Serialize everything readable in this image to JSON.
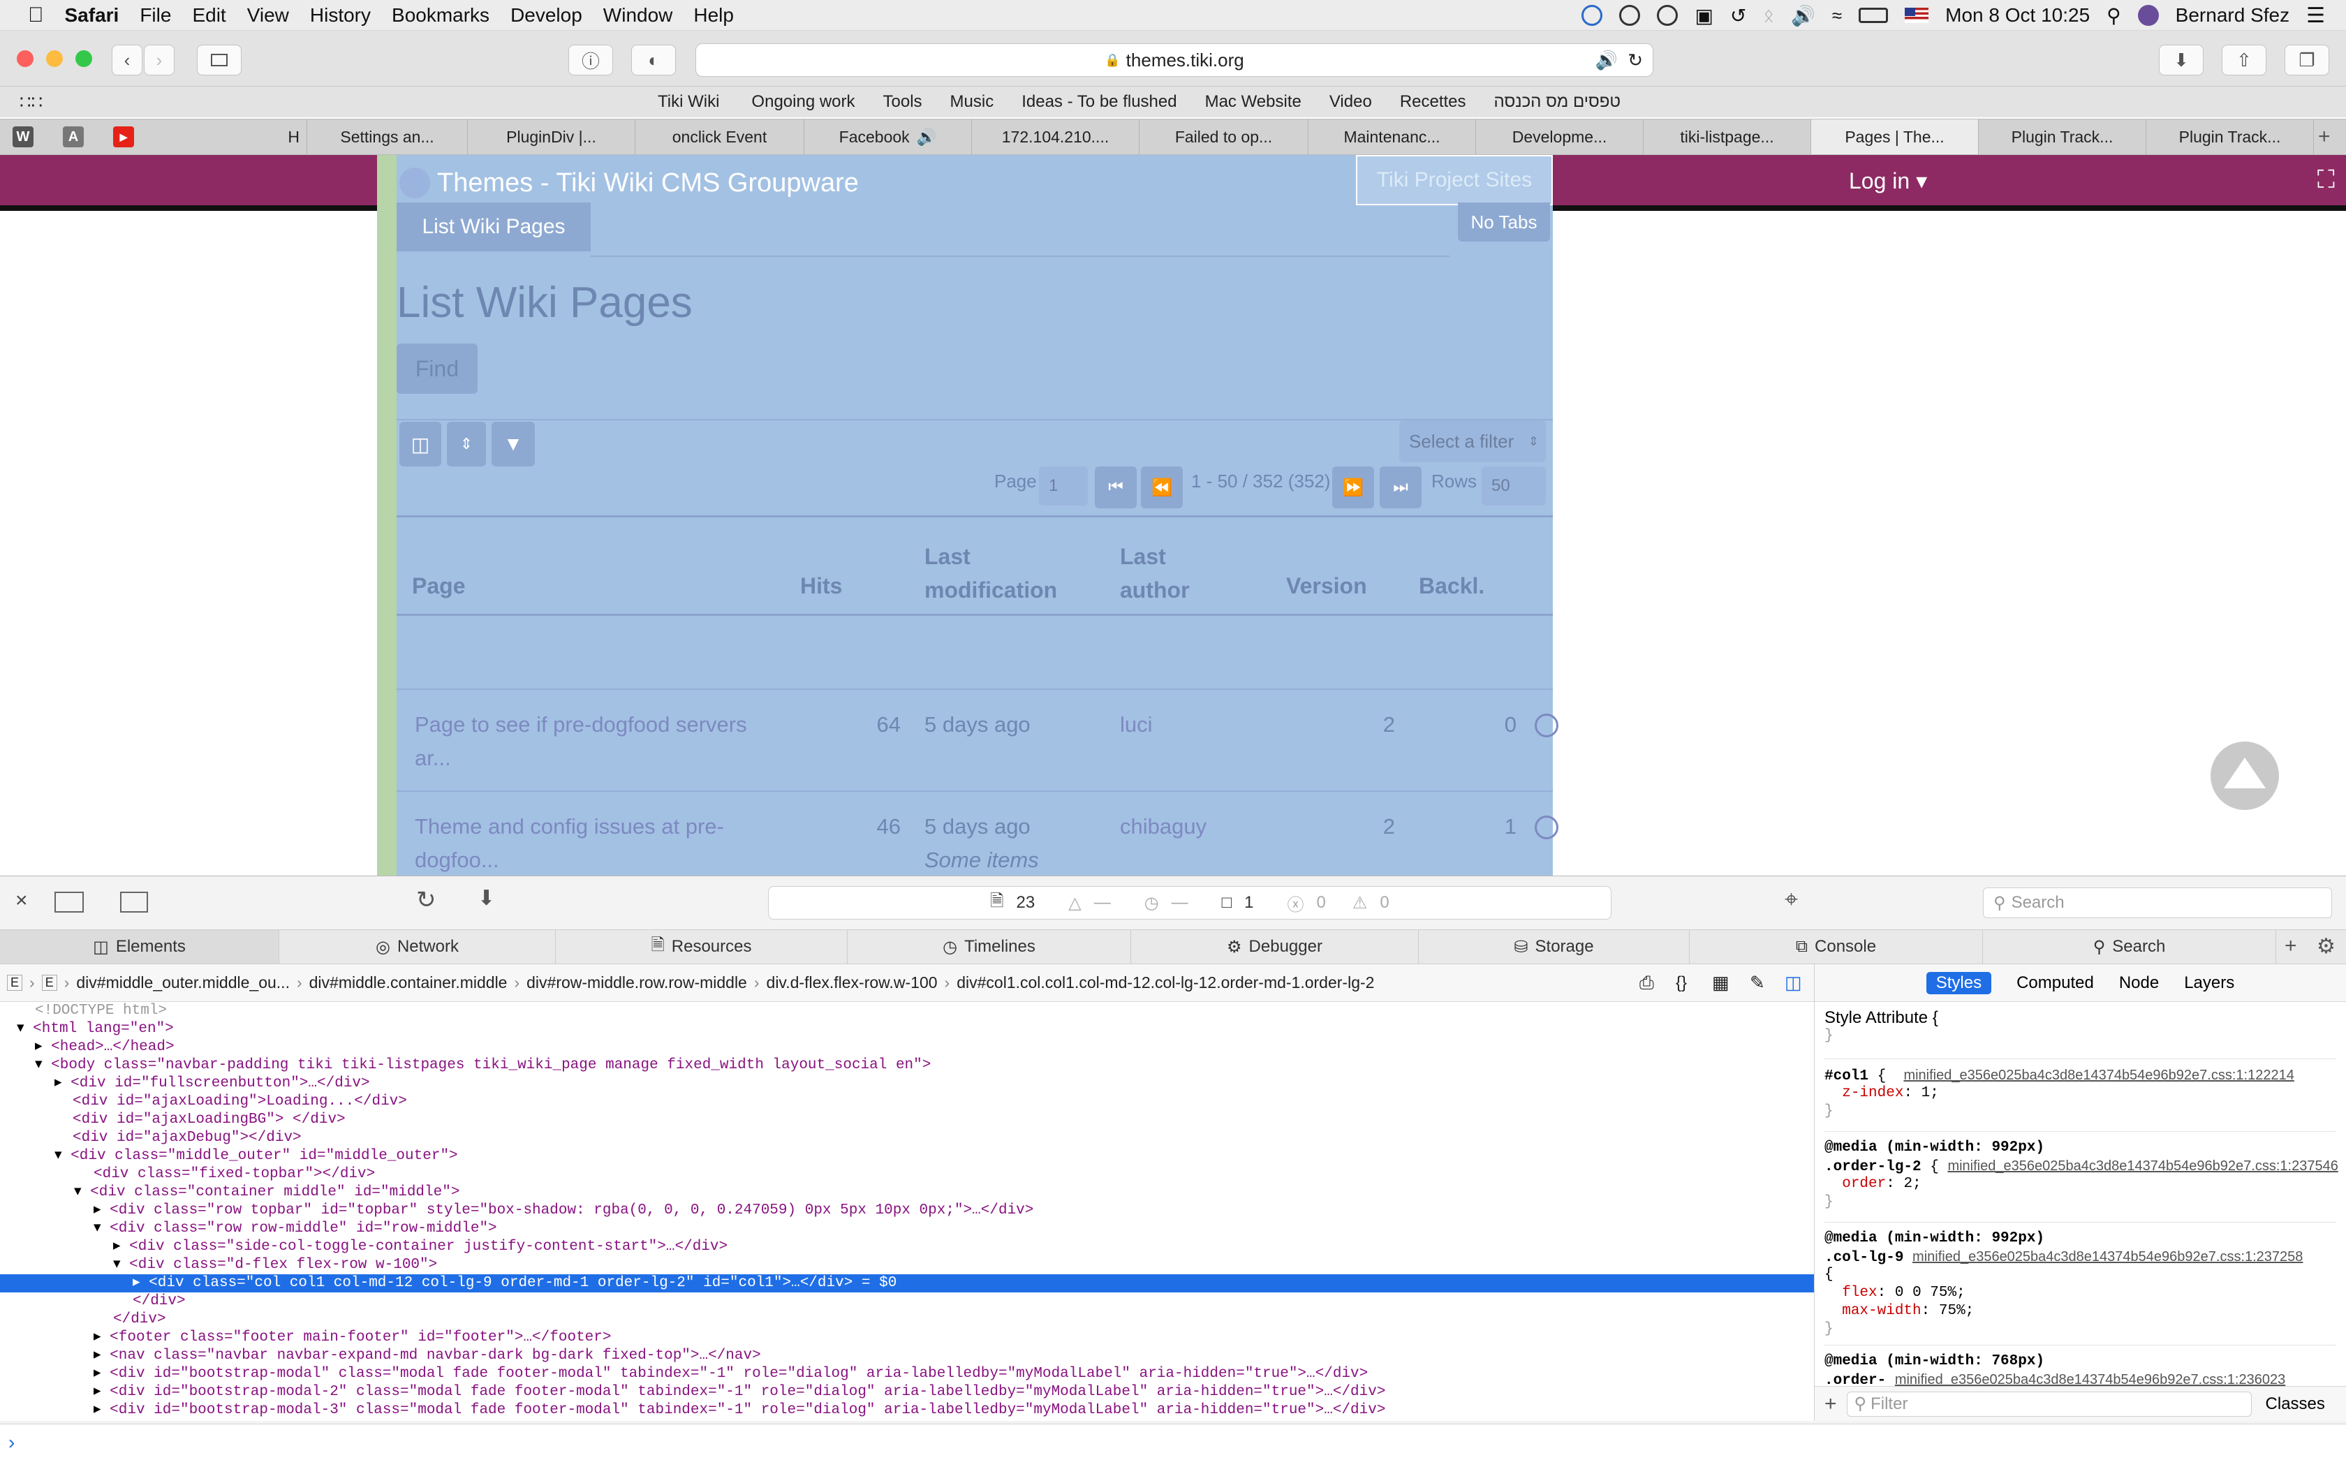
{
  "menubar": {
    "app": "Safari",
    "items": [
      "File",
      "Edit",
      "View",
      "History",
      "Bookmarks",
      "Develop",
      "Window",
      "Help"
    ],
    "datetime": "Mon 8 Oct  10:25",
    "user": "Bernard Sfez"
  },
  "toolbar": {
    "url": "themes.tiki.org"
  },
  "favorites": [
    "Tiki Wiki",
    "Ongoing work",
    "Tools",
    "Music",
    "Ideas - To be flushed",
    "Mac Website",
    "Video",
    "Recettes",
    "טפסים מס הכנסה"
  ],
  "tabs": [
    "H",
    "Settings an...",
    "PluginDiv |...",
    "onclick Event",
    "Facebook",
    "172.104.210....",
    "Failed to op...",
    "Maintenanc...",
    "Developme...",
    "tiki-listpage...",
    "Pages | The...",
    "Plugin Track...",
    "Plugin Track..."
  ],
  "pinned": [
    "W",
    "A",
    ""
  ],
  "page": {
    "site_title": "Themes - Tiki Wiki CMS Groupware",
    "dropdown": "Tiki Project Sites",
    "login": "Log in",
    "tab_label": "List Wiki Pages",
    "no_tabs": "No Tabs",
    "heading": "List Wiki Pages",
    "find": "Find",
    "filter": "Select a filter",
    "pagination": {
      "page_label": "Page",
      "page_value": "1",
      "range": "1 - 50 / 352 (352)",
      "rows_label": "Rows",
      "rows_value": "50"
    },
    "columns": [
      "Page",
      "Hits",
      "Last modification",
      "Last author",
      "Version",
      "Backl."
    ],
    "rows": [
      {
        "page": "Page to see if pre-dogfood servers ar...",
        "hits": "64",
        "modified": "5 days ago",
        "author": "luci",
        "version": "2",
        "backlinks": "0",
        "note": ""
      },
      {
        "page": "Theme and config issues at pre-dogfoo...",
        "hits": "46",
        "modified": "5 days ago",
        "author": "chibaguy",
        "version": "2",
        "backlinks": "1",
        "note": "Some items"
      }
    ]
  },
  "devtools": {
    "summary": {
      "resources": "23",
      "dash1": "—",
      "dash2": "—",
      "logs": "1",
      "errors": "0",
      "warnings": "0"
    },
    "search_placeholder": "Search",
    "tabs": [
      "Elements",
      "Network",
      "Resources",
      "Timelines",
      "Debugger",
      "Storage",
      "Console",
      "Search"
    ],
    "breadcrumbs": [
      "E",
      "E",
      "div#middle_outer.middle_ou...",
      "div#middle.container.middle",
      "div#row-middle.row.row-middle",
      "div.d-flex.flex-row.w-100",
      "div#col1.col.col1.col-md-12.col-lg-12.order-md-1.order-lg-2"
    ],
    "side_tabs": [
      "Styles",
      "Computed",
      "Node",
      "Layers"
    ],
    "filter_placeholder": "Filter",
    "classes": "Classes",
    "styles": {
      "style_attr": "Style Attribute",
      "r1_sel": "#col1",
      "r1_src": "minified_e356e025ba4c3d8e14374b54e96b92e7.css:1:122214",
      "r1_prop": "z-index",
      "r1_val": "1",
      "r2_media": "@media (min-width: 992px)",
      "r2_sel": ".order-lg-2",
      "r2_src": "minified_e356e025ba4c3d8e14374b54e96b92e7.css:1:237546",
      "r2_prop": "order",
      "r2_val": "2",
      "r3_media": "@media (min-width: 992px)",
      "r3_sel": ".col-lg-9",
      "r3_src": "minified_e356e025ba4c3d8e14374b54e96b92e7.css:1:237258",
      "r3_p1": "flex",
      "r3_v1": "0 0 75%",
      "r3_p2": "max-width",
      "r3_v2": "75%",
      "r4_media": "@media (min-width: 768px)",
      "r4_sel": ".order-",
      "r4_src": "minified_e356e025ba4c3d8e14374b54e96b92e7.css:1:236023"
    },
    "dom_lines": [
      "<!DOCTYPE html>",
      "<html lang=\"en\">",
      "<head>…</head>",
      "<body class=\"navbar-padding tiki tiki-listpages tiki_wiki_page manage fixed_width layout_social en\">",
      "<div id=\"fullscreenbutton\">…</div>",
      "<div id=\"ajaxLoading\">Loading...</div>",
      "<div id=\"ajaxLoadingBG\"> </div>",
      "<div id=\"ajaxDebug\"></div>",
      "<div class=\"middle_outer\" id=\"middle_outer\">",
      "<div class=\"fixed-topbar\"></div>",
      "<div class=\"container middle\" id=\"middle\">",
      "<div class=\"row topbar\" id=\"topbar\" style=\"box-shadow: rgba(0, 0, 0, 0.247059) 0px 5px 10px 0px;\">…</div>",
      "<div class=\"row row-middle\" id=\"row-middle\">",
      "<div class=\"side-col-toggle-container justify-content-start\">…</div>",
      "<div class=\"d-flex flex-row w-100\">",
      "<div class=\"col col1 col-md-12 col-lg-9 order-md-1 order-lg-2\" id=\"col1\">…</div> = $0",
      "</div>",
      "</div>",
      "<footer class=\"footer main-footer\" id=\"footer\">…</footer>",
      "<nav class=\"navbar navbar-expand-md navbar-dark bg-dark fixed-top\">…</nav>",
      "<div id=\"bootstrap-modal\" class=\"modal fade footer-modal\" tabindex=\"-1\" role=\"dialog\" aria-labelledby=\"myModalLabel\" aria-hidden=\"true\">…</div>",
      "<div id=\"bootstrap-modal-2\" class=\"modal fade footer-modal\" tabindex=\"-1\" role=\"dialog\" aria-labelledby=\"myModalLabel\" aria-hidden=\"true\">…</div>",
      "<div id=\"bootstrap-modal-3\" class=\"modal fade footer-modal\" tabindex=\"-1\" role=\"dialog\" aria-labelledby=\"myModalLabel\" aria-hidden=\"true\">…</div>"
    ]
  }
}
